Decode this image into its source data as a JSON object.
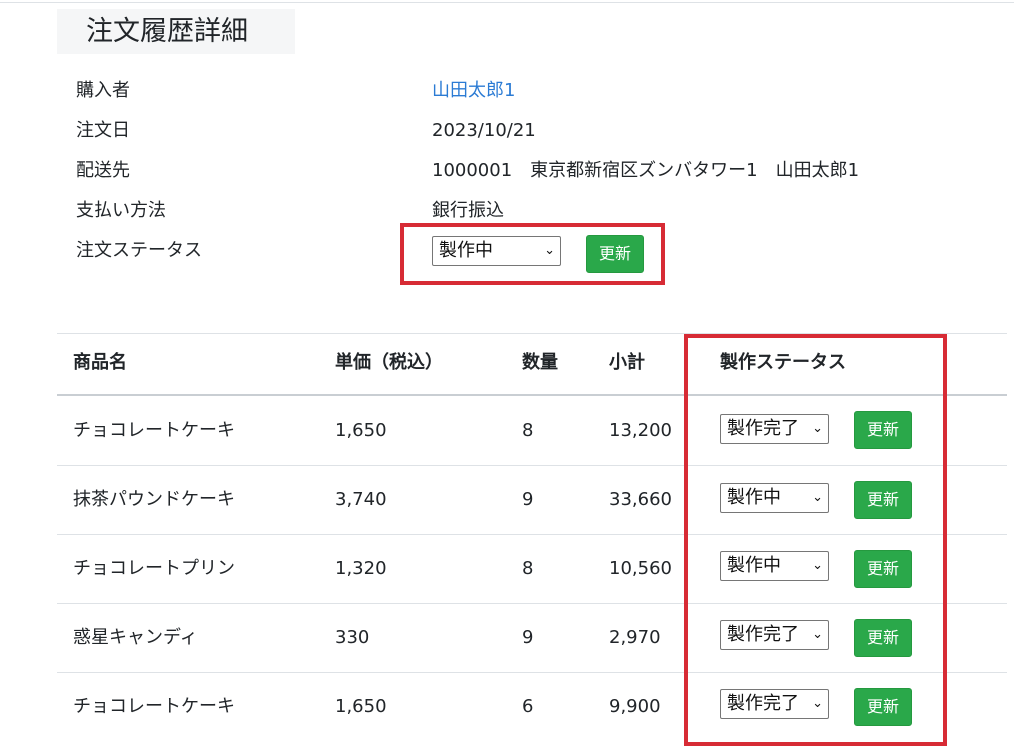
{
  "page": {
    "title": "注文履歴詳細"
  },
  "order": {
    "buyer": {
      "label": "購入者",
      "value": "山田太郎1"
    },
    "date": {
      "label": "注文日",
      "value": "2023/10/21"
    },
    "address": {
      "label": "配送先",
      "value": "1000001　東京都新宿区ズンバタワー1　山田太郎1"
    },
    "payment": {
      "label": "支払い方法",
      "value": "銀行振込"
    },
    "status": {
      "label": "注文ステータス",
      "selected": "製作中",
      "update_label": "更新"
    }
  },
  "items_table": {
    "headers": {
      "name": "商品名",
      "price": "単価（税込）",
      "qty": "数量",
      "subtotal": "小計",
      "production_status": "製作ステータス"
    },
    "rows": [
      {
        "name": "チョコレートケーキ",
        "price": "1,650",
        "qty": "8",
        "subtotal": "13,200",
        "status": "製作完了",
        "update_label": "更新"
      },
      {
        "name": "抹茶パウンドケーキ",
        "price": "3,740",
        "qty": "9",
        "subtotal": "33,660",
        "status": "製作中",
        "update_label": "更新"
      },
      {
        "name": "チョコレートプリン",
        "price": "1,320",
        "qty": "8",
        "subtotal": "10,560",
        "status": "製作中",
        "update_label": "更新"
      },
      {
        "name": "惑星キャンディ",
        "price": "330",
        "qty": "9",
        "subtotal": "2,970",
        "status": "製作完了",
        "update_label": "更新"
      },
      {
        "name": "チョコレートケーキ",
        "price": "1,650",
        "qty": "6",
        "subtotal": "9,900",
        "status": "製作完了",
        "update_label": "更新"
      }
    ]
  },
  "icons": {
    "select_arrow": "chevron-down-icon"
  },
  "colors": {
    "accent_green": "#2aa84a",
    "highlight_red": "#d72b35",
    "link_blue": "#2b7bd4"
  }
}
